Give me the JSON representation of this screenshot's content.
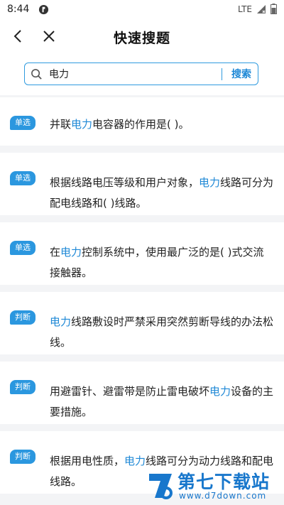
{
  "status_bar": {
    "time": "8:44",
    "network": "LTE"
  },
  "header": {
    "title": "快速搜题"
  },
  "search": {
    "query": "电力",
    "button_label": "搜索"
  },
  "results": [
    {
      "tag": "单选",
      "parts": [
        {
          "t": "并联",
          "h": false
        },
        {
          "t": "电力",
          "h": true
        },
        {
          "t": "电容器的作用是( )。",
          "h": false
        }
      ]
    },
    {
      "tag": "单选",
      "parts": [
        {
          "t": "根据线路电压等级和用户对象，",
          "h": false
        },
        {
          "t": "电力",
          "h": true
        },
        {
          "t": "线路可分为配电线路和( )线路。",
          "h": false
        }
      ]
    },
    {
      "tag": "单选",
      "parts": [
        {
          "t": "在",
          "h": false
        },
        {
          "t": "电力",
          "h": true
        },
        {
          "t": "控制系统中，使用最广泛的是( )式交流接触器。",
          "h": false
        }
      ]
    },
    {
      "tag": "判断",
      "parts": [
        {
          "t": "电力",
          "h": true
        },
        {
          "t": "线路敷设时严禁采用突然剪断导线的办法松线。",
          "h": false
        }
      ]
    },
    {
      "tag": "判断",
      "parts": [
        {
          "t": "用避雷针、避雷带是防止雷电破坏",
          "h": false
        },
        {
          "t": "电力",
          "h": true
        },
        {
          "t": "设备的主要措施。",
          "h": false
        }
      ]
    },
    {
      "tag": "判断",
      "parts": [
        {
          "t": "根据用电性质，",
          "h": false
        },
        {
          "t": "电力",
          "h": true
        },
        {
          "t": "线路可分为动力线路和配电线路。",
          "h": false
        }
      ]
    }
  ],
  "watermark": {
    "name": "第七下载站",
    "url": "www.d7down.com"
  },
  "colors": {
    "accent": "#2b97df",
    "highlight": "#1e88d6",
    "background": "#f3f4f6"
  }
}
